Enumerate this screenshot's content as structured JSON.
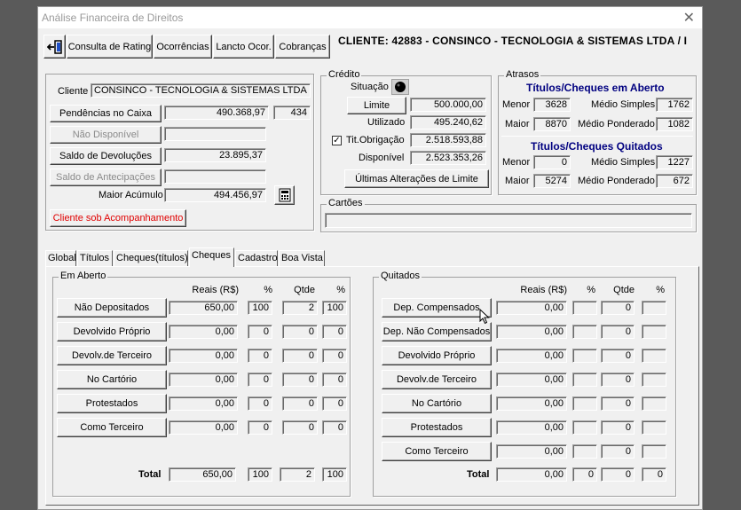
{
  "window": {
    "title": "Análise Financeira de Direitos",
    "close_glyph": "✕"
  },
  "toolbar": {
    "exit_icon": "exit-door-icon",
    "buttons": [
      "Consulta de Rating",
      "Ocorrências",
      "Lancto Ocor.",
      "Cobranças"
    ],
    "client_header": "CLIENTE: 42883 - CONSINCO - TECNOLOGIA & SISTEMAS LTDA  /  I"
  },
  "cliente_panel": {
    "cliente_label": "Cliente",
    "cliente_value": "CONSINCO - TECNOLOGIA & SISTEMAS LTDA",
    "pendencias_button": "Pendências no Caixa",
    "pendencias_value": "490.368,97",
    "pendencias_count": "434",
    "nao_disponivel_button": "Não Disponível",
    "nao_disponivel_value": "",
    "saldo_devolucoes_button": "Saldo de Devoluções",
    "saldo_devolucoes_value": "23.895,37",
    "saldo_antecipacoes_button": "Saldo de Antecipações",
    "saldo_antecipacoes_value": "",
    "maior_acumulo_label": "Maior Acúmulo",
    "maior_acumulo_value": "494.456,97",
    "acompanhamento_button": "Cliente sob Acompanhamento"
  },
  "credito": {
    "title": "Crédito",
    "situacao_label": "Situação",
    "limite_button": "Limite",
    "limite_value": "500.000,00",
    "utilizado_label": "Utilizado",
    "utilizado_value": "495.240,62",
    "tit_obrigacao_label": "Tit.Obrigação",
    "tit_obrigacao_checked": true,
    "tit_obrigacao_check_glyph": "✓",
    "tit_obrigacao_value": "2.518.593,88",
    "disponivel_label": "Disponível",
    "disponivel_value": "2.523.353,26",
    "ultimas_button": "Últimas Alterações de Limite"
  },
  "atrasos": {
    "title": "Atrasos",
    "aberto_title": "Títulos/Cheques em Aberto",
    "quitados_title": "Títulos/Cheques Quitados",
    "menor_label": "Menor",
    "maior_label": "Maior",
    "medio_simples_label": "Médio Simples",
    "medio_ponderado_label": "Médio Ponderado",
    "aberto": {
      "menor": "3628",
      "maior": "8870",
      "medio_simples": "1762",
      "medio_ponderado": "1082"
    },
    "quitados": {
      "menor": "0",
      "maior": "5274",
      "medio_simples": "1227",
      "medio_ponderado": "672"
    }
  },
  "cartoes": {
    "title": "Cartões",
    "value": ""
  },
  "tabs": [
    "Global",
    "Títulos",
    "Cheques(títulos)",
    "Cheques",
    "Cadastro",
    "Boa Vista"
  ],
  "active_tab": "Cheques",
  "em_aberto": {
    "title": "Em Aberto",
    "headers": [
      "Reais (R$)",
      "%",
      "Qtde",
      "%"
    ],
    "rows": [
      {
        "label": "Não Depositados",
        "reais": "650,00",
        "pct": "100",
        "qtde": "2",
        "pct2": "100"
      },
      {
        "label": "Devolvido Próprio",
        "reais": "0,00",
        "pct": "0",
        "qtde": "0",
        "pct2": "0"
      },
      {
        "label": "Devolv.de Terceiro",
        "reais": "0,00",
        "pct": "0",
        "qtde": "0",
        "pct2": "0"
      },
      {
        "label": "No Cartório",
        "reais": "0,00",
        "pct": "0",
        "qtde": "0",
        "pct2": "0"
      },
      {
        "label": "Protestados",
        "reais": "0,00",
        "pct": "0",
        "qtde": "0",
        "pct2": "0"
      },
      {
        "label": "Como Terceiro",
        "reais": "0,00",
        "pct": "0",
        "qtde": "0",
        "pct2": "0"
      }
    ],
    "total": {
      "label": "Total",
      "reais": "650,00",
      "pct": "100",
      "qtde": "2",
      "pct2": "100"
    }
  },
  "quitados": {
    "title": "Quitados",
    "headers": [
      "Reais (R$)",
      "%",
      "Qtde",
      "%"
    ],
    "rows": [
      {
        "label": "Dep. Compensados",
        "reais": "0,00",
        "pct": "",
        "qtde": "0",
        "pct2": ""
      },
      {
        "label": "Dep. Não Compensados",
        "reais": "0,00",
        "pct": "",
        "qtde": "0",
        "pct2": ""
      },
      {
        "label": "Devolvido Próprio",
        "reais": "0,00",
        "pct": "",
        "qtde": "0",
        "pct2": ""
      },
      {
        "label": "Devolv.de Terceiro",
        "reais": "0,00",
        "pct": "",
        "qtde": "0",
        "pct2": ""
      },
      {
        "label": "No Cartório",
        "reais": "0,00",
        "pct": "",
        "qtde": "0",
        "pct2": ""
      },
      {
        "label": "Protestados",
        "reais": "0,00",
        "pct": "",
        "qtde": "0",
        "pct2": ""
      },
      {
        "label": "Como Terceiro",
        "reais": "0,00",
        "pct": "",
        "qtde": "0",
        "pct2": ""
      }
    ],
    "total": {
      "label": "Total",
      "reais": "0,00",
      "pct": "0",
      "qtde": "0",
      "pct2": "0"
    }
  }
}
